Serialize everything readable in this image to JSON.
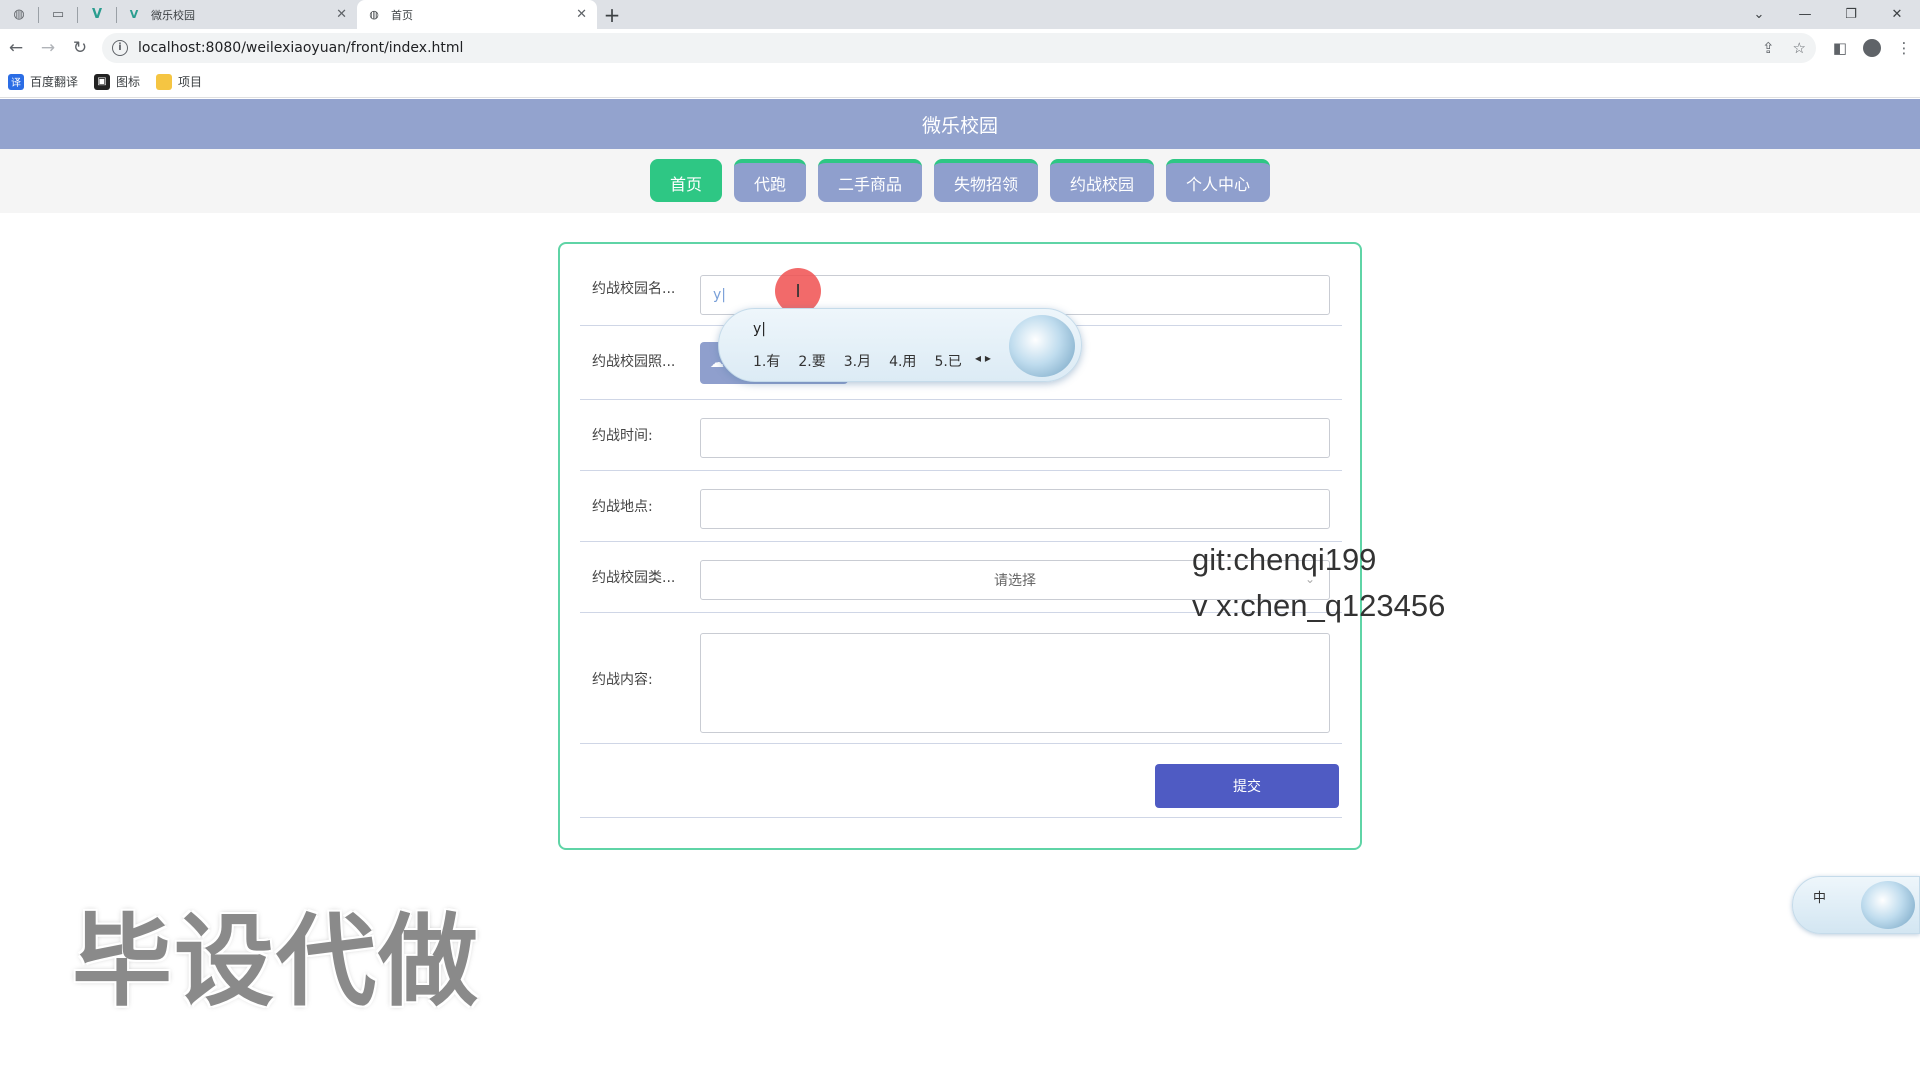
{
  "browser": {
    "tabs": [
      {
        "title": "",
        "active": false
      },
      {
        "title": "",
        "active": false
      },
      {
        "title": "",
        "active": false
      },
      {
        "title": "微乐校园",
        "active": false
      },
      {
        "title": "首页",
        "active": true
      }
    ],
    "url": "localhost:8080/weilexiaoyuan/front/index.html",
    "bookmarks": [
      {
        "label": "百度翻译",
        "color": "#2b6de5"
      },
      {
        "label": "图标",
        "color": "#222222"
      },
      {
        "label": "项目",
        "color": "#f5c542"
      }
    ]
  },
  "site": {
    "title": "微乐校园",
    "nav": [
      "首页",
      "代跑",
      "二手商品",
      "失物招领",
      "约战校园",
      "个人中心"
    ]
  },
  "form": {
    "name_label": "约战校园名...",
    "name_value": "y|",
    "photo_label": "约战校园照...",
    "time_label": "约战时间:",
    "place_label": "约战地点:",
    "type_label": "约战校园类...",
    "type_placeholder": "请选择",
    "content_label": "约战内容:",
    "submit_label": "提交"
  },
  "ime": {
    "input": "y|",
    "candidates": [
      "1.有",
      "2.要",
      "3.月",
      "4.用",
      "5.已"
    ],
    "mini_mode": "中"
  },
  "overlay": {
    "line1": "git:chenqi199",
    "line2": "v x:chen_q123456",
    "watermark": "毕设代做"
  },
  "colors": {
    "header_bg": "#93a3ce",
    "nav_active": "#2ec784",
    "submit_bg": "#4f5bc3"
  }
}
